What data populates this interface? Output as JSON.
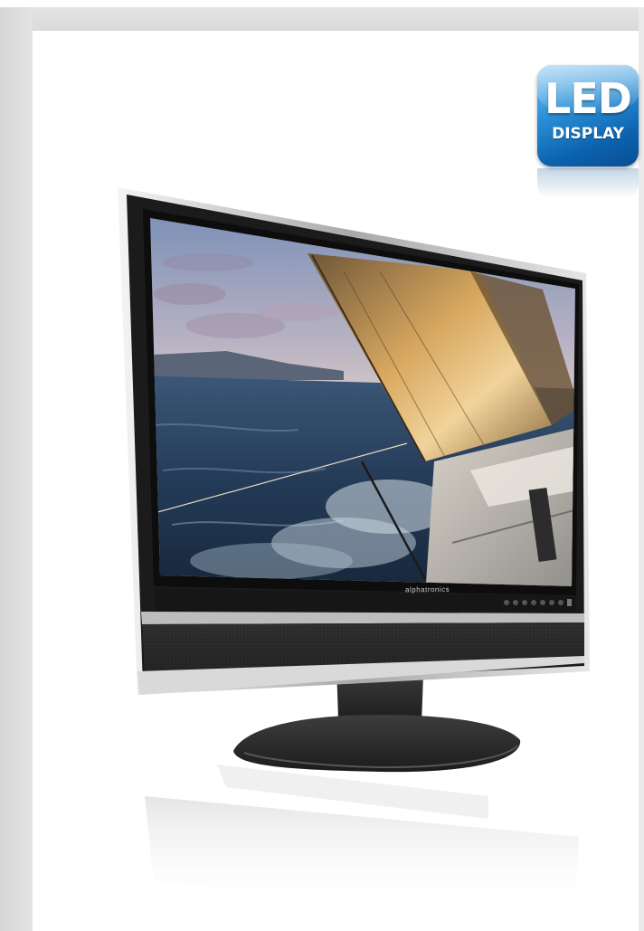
{
  "badge": {
    "line1": "LED",
    "line2": "DISPLAY",
    "color": "#1b7cc8"
  },
  "monitor": {
    "brand": "alphatronics",
    "screen_image": "sailboat-ocean-sunset",
    "bezel_color": "#1a1a1a",
    "stand_color": "#2b2b2b"
  }
}
